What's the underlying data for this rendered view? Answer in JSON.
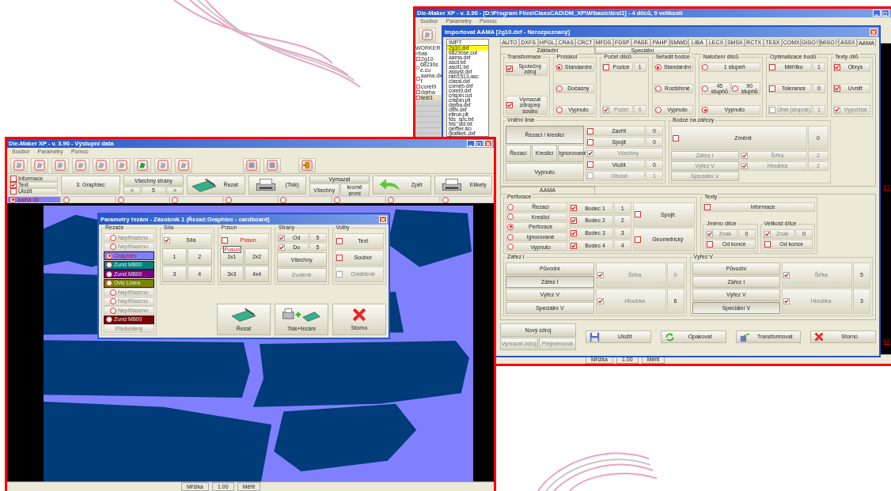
{
  "right_window": {
    "title": "Die-Maker XP - v. 3.90 - [D:\\Program Files\\ClassCAD\\DM_XP\\W\\basic\\test1] - 4 dílců, 9 velikostí",
    "menu": [
      "Soubor",
      "Parametry",
      "Pomoc"
    ],
    "tree": {
      "label": "WORKER <bas",
      "children": [
        {
          "label": "2g10",
          "selected": false
        },
        {
          "label": "68230se.cu",
          "selected": false
        },
        {
          "label": "aama.dxf",
          "selected": false
        },
        {
          "label": "corel9",
          "selected": false
        },
        {
          "label": "dgrba",
          "selected": false
        },
        {
          "label": "test1",
          "selected": true
        }
      ]
    },
    "canvas_labels": [
      "97",
      "88"
    ],
    "status": [
      "Mřížka",
      "1.00",
      "Měřit"
    ]
  },
  "import_dialog": {
    "title": "Importovat AAMA [2g10.dxf - Nerozpoznaný]",
    "file_header": "IMPT",
    "files": [
      {
        "label": "2g10.dxf",
        "selected": true
      },
      {
        "label": "68230se.cut",
        "selected": false
      },
      {
        "label": "aama.dxf",
        "selected": false
      },
      {
        "label": "ascii.txt",
        "selected": false
      },
      {
        "label": "ascii1.txt",
        "selected": false
      },
      {
        "label": "assyst.dxf",
        "selected": false
      },
      {
        "label": "bkb1513.asc",
        "selected": false
      },
      {
        "label": "classi.dxf",
        "selected": false
      },
      {
        "label": "comeb.dxf",
        "selected": false
      },
      {
        "label": "corel9.dxf",
        "selected": false
      },
      {
        "label": "crispin.cut",
        "selected": false
      },
      {
        "label": "crispin.plt",
        "selected": false
      },
      {
        "label": "dgrba.dxf",
        "selected": false
      },
      {
        "label": "dxfx.dxf",
        "selected": false
      },
      {
        "label": "eltron.plt",
        "selected": false
      },
      {
        "label": "fds_spc.txt",
        "selected": false
      },
      {
        "label": "fds_std.txt",
        "selected": false
      },
      {
        "label": "gerber.iso",
        "selected": false
      },
      {
        "label": "grafiket..dxf",
        "selected": false
      }
    ],
    "format_tabs": [
      {
        "label": "AUTO",
        "selected": false
      },
      {
        "label": "DXFS",
        "selected": false
      },
      {
        "label": "HPGL",
        "selected": false
      },
      {
        "label": "CRAS",
        "selected": false
      },
      {
        "label": "CRCT",
        "selected": false
      },
      {
        "label": "MFDS",
        "selected": false
      },
      {
        "label": "FDSP",
        "selected": false
      },
      {
        "label": "PASE",
        "selected": false
      },
      {
        "label": "PAHP",
        "selected": false
      },
      {
        "label": "SMWD",
        "selected": false
      },
      {
        "label": "LIBA",
        "selected": false
      },
      {
        "label": "LECX",
        "selected": false
      },
      {
        "label": "SMSX",
        "selected": false
      },
      {
        "label": "RCTX",
        "selected": false
      },
      {
        "label": "TESX",
        "selected": false
      },
      {
        "label": "COMX",
        "selected": false
      },
      {
        "label": "GISO?",
        "selected": false
      },
      {
        "label": "MISO?",
        "selected": false
      },
      {
        "label": "ASSX",
        "selected": false
      },
      {
        "label": "AAMA",
        "selected": true
      }
    ],
    "sub_tabs": [
      {
        "label": "Základní",
        "selected": true
      },
      {
        "label": "Speciální",
        "selected": false
      }
    ],
    "upper_rows": [
      [
        {
          "title": "Transformace",
          "rows": [
            [
              {
                "kind": "check",
                "label": "Společný zdroj",
                "checked": true
              }
            ],
            [
              {
                "kind": "check",
                "label": "Vymazat zdrojový soubo",
                "checked": true
              }
            ]
          ]
        },
        {
          "title": "Protokol",
          "rows": [
            [
              {
                "kind": "radio",
                "label": "Standardní",
                "selected": true
              }
            ],
            [
              {
                "kind": "radio",
                "label": "Dočasný",
                "selected": false
              }
            ],
            [
              {
                "kind": "radio",
                "label": "Vypnuto",
                "selected": false
              }
            ]
          ]
        },
        {
          "title": "Počet dílců",
          "rows": [
            [
              {
                "kind": "check",
                "label": "Pozice",
                "checked": false
              },
              {
                "kind": "value",
                "value": "1"
              }
            ],
            [
              {
                "kind": "check",
                "label": "Počet",
                "checked": true,
                "disabled": true
              },
              {
                "kind": "value",
                "value": "0",
                "disabled": true
              }
            ]
          ]
        },
        {
          "title": "Seřadit bodce",
          "rows": [
            [
              {
                "kind": "radio",
                "label": "Standardní",
                "selected": true
              }
            ],
            [
              {
                "kind": "radio",
                "label": "Rozšířené",
                "selected": false
              }
            ],
            [
              {
                "kind": "radio",
                "label": "Vypnuto",
                "selected": false
              }
            ]
          ]
        },
        {
          "title": "Natočení dílců",
          "rows": [
            [
              {
                "kind": "radio",
                "label": "1 stupeň",
                "selected": false
              }
            ],
            [
              {
                "kind": "radio",
                "label": "45 stupňů",
                "selected": false
              },
              {
                "kind": "radio",
                "label": "90 stupňů",
                "selected": false
              }
            ],
            [
              {
                "kind": "radio",
                "label": "Vypnuto",
                "selected": true
              }
            ]
          ]
        },
        {
          "title": "Optimalizace bodů",
          "rows": [
            [
              {
                "kind": "check",
                "label": "Měřítko",
                "checked": false
              },
              {
                "kind": "value",
                "value": "1"
              }
            ],
            [
              {
                "kind": "check",
                "label": "Tolerance",
                "checked": false
              },
              {
                "kind": "value",
                "value": "0"
              }
            ],
            [
              {
                "kind": "check",
                "label": "Úhel (stupně)",
                "checked": false,
                "disabled": true
              },
              {
                "kind": "value",
                "value": "1",
                "disabled": true
              }
            ]
          ]
        },
        {
          "title": "Texty dílů",
          "rows": [
            [
              {
                "kind": "check",
                "label": "Obrys",
                "checked": true
              }
            ],
            [
              {
                "kind": "check",
                "label": "Uvnitř",
                "checked": true
              }
            ],
            [
              {
                "kind": "check",
                "label": "Vypočítat",
                "checked": true,
                "disabled": true
              }
            ]
          ]
        }
      ],
      [
        {
          "title": "Vnitřní linie",
          "columns": [
            [
              [
                {
                  "kind": "button",
                  "label": "Řezací / kreslicí",
                  "selected": true
                }
              ],
              [
                {
                  "kind": "button",
                  "label": "Řezací",
                  "selected": false
                },
                {
                  "kind": "button",
                  "label": "Kreslicí",
                  "selected": false
                },
                {
                  "kind": "button",
                  "label": "Ignorované",
                  "selected": false
                }
              ],
              [
                {
                  "kind": "button",
                  "label": "Vypnuto",
                  "selected": false
                }
              ]
            ],
            [
              [
                {
                  "kind": "check",
                  "label": "Zavřít",
                  "checked": false
                },
                {
                  "kind": "value",
                  "value": "0"
                }
              ],
              [
                {
                  "kind": "check",
                  "label": "Spojit",
                  "checked": false
                },
                {
                  "kind": "value",
                  "value": "0"
                }
              ],
              [
                {
                  "kind": "check",
                  "label": "Všechny",
                  "checked": true,
                  "disabled": true
                }
              ],
              [
                {
                  "kind": "check",
                  "label": "Vložit",
                  "checked": false
                },
                {
                  "kind": "value",
                  "value": "0"
                }
              ],
              [
                {
                  "kind": "check",
                  "label": "Obvod",
                  "checked": false,
                  "disabled": true
                },
                {
                  "kind": "value",
                  "value": "1",
                  "disabled": true
                }
              ]
            ]
          ]
        },
        {
          "title": "Bodce na zářezy",
          "head": [
            {
              "kind": "check",
              "label": "Změnit",
              "checked": false
            },
            {
              "kind": "value",
              "value": "0"
            }
          ],
          "rows": [
            [
              {
                "kind": "button",
                "label": "Zářez I",
                "selected": false,
                "disabled": true
              },
              {
                "kind": "check",
                "label": "Šířka",
                "checked": true,
                "disabled": true
              },
              {
                "kind": "value",
                "value": "2",
                "disabled": true
              }
            ],
            [
              {
                "kind": "button",
                "label": "Výřez V",
                "selected": false,
                "disabled": true
              },
              {
                "kind": "check",
                "label": "Hloubka",
                "checked": true,
                "disabled": true
              },
              {
                "kind": "value",
                "value": "2",
                "disabled": true
              }
            ],
            [
              {
                "kind": "button",
                "label": "Speciální V",
                "selected": false,
                "disabled": true
              }
            ]
          ]
        }
      ]
    ],
    "lower_tab": {
      "label": "AAMA",
      "selected": true
    },
    "lower_rows": [
      [
        {
          "title": "Perforace",
          "columns": [
            [
              [
                {
                  "kind": "radio",
                  "label": "Řezací",
                  "selected": false
                }
              ],
              [
                {
                  "kind": "radio",
                  "label": "Kreslicí",
                  "selected": false
                }
              ],
              [
                {
                  "kind": "radio",
                  "label": "Perforace",
                  "selected": true
                }
              ],
              [
                {
                  "kind": "radio",
                  "label": "Ignorované",
                  "selected": false
                }
              ],
              [
                {
                  "kind": "radio",
                  "label": "Vypnuto",
                  "selected": false
                }
              ]
            ],
            [
              [
                {
                  "kind": "check",
                  "label": "Bodec 1",
                  "checked": true
                },
                {
                  "kind": "value",
                  "value": "1"
                }
              ],
              [
                {
                  "kind": "check",
                  "label": "Bodec 2",
                  "checked": true
                },
                {
                  "kind": "value",
                  "value": "2"
                }
              ],
              [
                {
                  "kind": "check",
                  "label": "Bodec 3",
                  "checked": true
                },
                {
                  "kind": "value",
                  "value": "3"
                }
              ],
              [
                {
                  "kind": "check",
                  "label": "Bodec 4",
                  "checked": true
                },
                {
                  "kind": "value",
                  "value": "4"
                }
              ]
            ],
            [
              [
                {
                  "kind": "check",
                  "label": "Spojit",
                  "checked": false
                }
              ],
              [
                {
                  "kind": "check",
                  "label": "Geometrický",
                  "checked": false
                }
              ]
            ]
          ]
        },
        {
          "title": "Texty",
          "rows": [
            [
              {
                "kind": "check",
                "label": "Informace",
                "checked": false
              }
            ]
          ],
          "subgroups": [
            {
              "title": "Jméno dílce",
              "rows": [
                [
                  {
                    "kind": "check",
                    "label": "Znak",
                    "checked": true,
                    "disabled": true
                  },
                  {
                    "kind": "value",
                    "value": "0"
                  }
                ],
                [
                  {
                    "kind": "check",
                    "label": "Od konce",
                    "checked": false
                  }
                ]
              ]
            },
            {
              "title": "Velikost dílce",
              "rows": [
                [
                  {
                    "kind": "check",
                    "label": "Znak",
                    "checked": true,
                    "disabled": true
                  },
                  {
                    "kind": "value",
                    "value": "0"
                  }
                ],
                [
                  {
                    "kind": "check",
                    "label": "Od konce",
                    "checked": false
                  }
                ]
              ]
            }
          ]
        }
      ],
      [
        {
          "title": "Zářez I",
          "columns": [
            [
              [
                {
                  "kind": "button",
                  "label": "Původní",
                  "selected": false
                }
              ],
              [
                {
                  "kind": "button",
                  "label": "Zářez I",
                  "selected": true
                }
              ],
              [
                {
                  "kind": "button",
                  "label": "Výřez V",
                  "selected": false
                }
              ],
              [
                {
                  "kind": "button",
                  "label": "Speciální V",
                  "selected": false
                }
              ]
            ],
            [
              [
                {
                  "kind": "check",
                  "label": "Šířka",
                  "checked": true,
                  "disabled": true
                },
                {
                  "kind": "value",
                  "value": "0",
                  "disabled": true
                }
              ],
              [
                {
                  "kind": "check",
                  "label": "Hloubka",
                  "checked": true,
                  "disabled": true
                },
                {
                  "kind": "value",
                  "value": "6"
                }
              ]
            ]
          ]
        },
        {
          "title": "Výřez V",
          "columns": [
            [
              [
                {
                  "kind": "button",
                  "label": "Původní",
                  "selected": false
                }
              ],
              [
                {
                  "kind": "button",
                  "label": "Zářez I",
                  "selected": false
                }
              ],
              [
                {
                  "kind": "button",
                  "label": "Výřez V",
                  "selected": false
                }
              ],
              [
                {
                  "kind": "button",
                  "label": "Speciální V",
                  "selected": true
                }
              ]
            ],
            [
              [
                {
                  "kind": "check",
                  "label": "Šířka",
                  "checked": true,
                  "disabled": true
                },
                {
                  "kind": "value",
                  "value": "5"
                }
              ],
              [
                {
                  "kind": "check",
                  "label": "Hloubka",
                  "checked": true,
                  "disabled": true
                },
                {
                  "kind": "value",
                  "value": "3"
                }
              ]
            ]
          ]
        }
      ]
    ],
    "source_buttons": [
      {
        "label": "Nový zdroj",
        "disabled": false
      },
      {
        "label": "Vymazat zdroj",
        "disabled": true
      },
      {
        "label": "Přejmenovat",
        "disabled": true
      }
    ],
    "actions": [
      {
        "kind": "save",
        "label": "Uložit"
      },
      {
        "kind": "repeat",
        "label": "Opakovat"
      },
      {
        "kind": "transform",
        "label": "Transformovat"
      },
      {
        "kind": "cancel",
        "label": "Storno"
      }
    ]
  },
  "left_window": {
    "title": "Die-Maker XP - v. 3.90 - Výstupní data",
    "menu": [
      "Soubor",
      "Parametry",
      "Pomoc"
    ],
    "options": [
      {
        "label": "Informace",
        "checked": false
      },
      {
        "label": "Text",
        "checked": true
      },
      {
        "label": "Uložit",
        "checked": false
      }
    ],
    "cutter_button": "3. Graphtec",
    "sides": {
      "label": "Všechny strany",
      "prev": "<",
      "value": "5",
      "next": ">"
    },
    "actions": [
      {
        "kind": "cutter",
        "label": "Řezat"
      },
      {
        "kind": "printer",
        "label": "(Tisk)"
      }
    ],
    "erase": {
      "label": "Vymazat",
      "all": "Všechny",
      "except_first": "kromě první"
    },
    "back": {
      "kind": "back",
      "label": "Zpět"
    },
    "labels": {
      "kind": "printer",
      "label": "Etikety"
    },
    "piece_tabs": [
      {
        "label": "aama díl",
        "selected": true
      },
      {
        "selected": false
      },
      {
        "selected": false
      },
      {
        "selected": false
      },
      {
        "selected": false
      },
      {
        "selected": false
      },
      {
        "selected": false
      },
      {
        "selected": false
      },
      {
        "selected": false
      }
    ],
    "status": [
      "Mřížka",
      "1.00",
      "Měřit"
    ]
  },
  "cut_dialog": {
    "title": "Parametry řezání - Zásobník 1 (Řezač:Graphtec - cardboard)",
    "cutters": {
      "title": "Řezače",
      "items": [
        {
          "label": "Nepřiřazeno",
          "selected": false,
          "disabled": true
        },
        {
          "label": "Nepřiřazeno",
          "selected": false,
          "disabled": true
        },
        {
          "label": "Graphtec",
          "selected": true,
          "disabled": false,
          "color": "#8080ff"
        },
        {
          "label": "Zund M800",
          "selected": false,
          "disabled": false,
          "color": "#008080"
        },
        {
          "label": "Zund M800",
          "selected": false,
          "disabled": false,
          "color": "#800080"
        },
        {
          "label": "Ovic Linea",
          "selected": false,
          "disabled": false,
          "color": "#808000"
        },
        {
          "label": "Nepřiřazeno",
          "selected": false,
          "disabled": true
        },
        {
          "label": "Nepřiřazeno",
          "selected": false,
          "disabled": true
        },
        {
          "label": "Nepřiřazeno",
          "selected": false,
          "disabled": true
        },
        {
          "label": "Zund M800",
          "selected": false,
          "disabled": false,
          "color": "#800000"
        }
      ],
      "default": "Předvolený"
    },
    "force": {
      "title": "Síla",
      "check": {
        "label": "Síla",
        "checked": true
      },
      "values": [
        "1",
        "2",
        "3",
        "4"
      ]
    },
    "offset": {
      "title": "Posun",
      "check": {
        "label": "Posun",
        "checked": false
      },
      "tooltip": "Posun",
      "values": [
        "1x1",
        "2x2",
        "3x3",
        "4x4"
      ]
    },
    "sides": {
      "title": "Strany",
      "ranges": [
        {
          "label": "Od",
          "checked": true,
          "value": "5"
        },
        {
          "label": "Do",
          "checked": true,
          "value": "5"
        }
      ],
      "buttons": [
        {
          "label": "Všechny",
          "disabled": false
        },
        {
          "label": "Zvolené",
          "disabled": true
        }
      ]
    },
    "options": {
      "title": "Volby",
      "items": [
        {
          "label": "Text",
          "checked": false,
          "disabled": false
        },
        {
          "label": "Soubor",
          "checked": false,
          "disabled": false
        },
        {
          "label": "Oddělené",
          "checked": false,
          "disabled": true
        }
      ]
    },
    "buttons": [
      {
        "kind": "cut",
        "label": "Řezat"
      },
      {
        "kind": "print_cut",
        "label": "Tisk+řezání"
      },
      {
        "kind": "cancel",
        "label": "Storno"
      }
    ]
  }
}
